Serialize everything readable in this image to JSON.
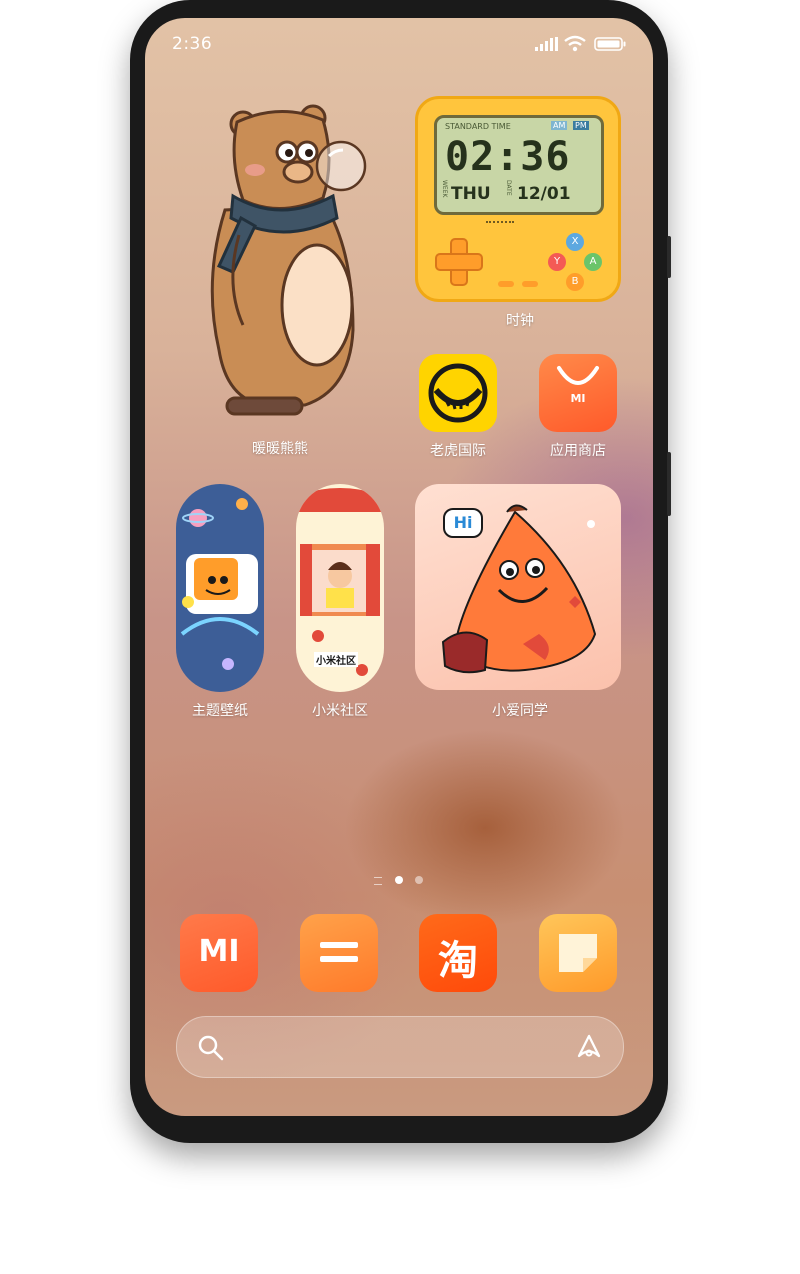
{
  "status_bar": {
    "time": "2:36"
  },
  "widgets": {
    "bear": {
      "label": "暖暖熊熊"
    },
    "clock": {
      "label": "时钟",
      "standard_time": "STANDARD TIME",
      "am": "AM",
      "pm": "PM",
      "time": "02:36",
      "week_label": "WEEK",
      "day": "THU",
      "date_label": "DATE",
      "date": "12/01",
      "btn_x": "X",
      "btn_y": "Y",
      "btn_a": "A",
      "btn_b": "B"
    },
    "theme": {
      "label": "主题壁纸"
    },
    "community": {
      "label": "小米社区",
      "sign": "小米社区"
    },
    "xiaoai": {
      "label": "小爱同学",
      "bubble": "Hi"
    }
  },
  "apps": {
    "tiger": {
      "label": "老虎国际"
    },
    "store": {
      "label": "应用商店",
      "logo": "MI"
    }
  },
  "dock": {
    "mi": {
      "logo": "MI"
    },
    "calculator": {
      "logo": "="
    },
    "taobao": {
      "logo": "淘"
    },
    "notes": {
      "logo": ""
    }
  },
  "colors": {
    "accent_orange": "#ff6a2b",
    "clock_yellow": "#ffc53d",
    "lcd_green": "#c8d6a6",
    "tiger_yellow": "#ffd400"
  }
}
